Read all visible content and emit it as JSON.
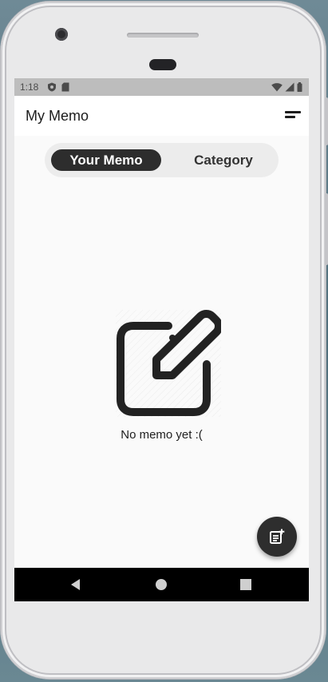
{
  "status_bar": {
    "time": "1:18",
    "icons": [
      "shield-icon",
      "sd-card-icon",
      "wifi-icon",
      "signal-icon",
      "battery-icon"
    ]
  },
  "app_bar": {
    "title": "My Memo",
    "menu_icon": "sort-menu-icon"
  },
  "tabs": [
    {
      "label": "Your Memo",
      "active": true
    },
    {
      "label": "Category",
      "active": false
    }
  ],
  "empty_state": {
    "icon": "edit-note-icon",
    "message": "No memo yet :("
  },
  "fab": {
    "icon": "add-note-icon"
  },
  "nav_bar": {
    "buttons": [
      "back-icon",
      "home-icon",
      "recents-icon"
    ]
  },
  "colors": {
    "accent": "#2d2d2d",
    "background": "#fafafa",
    "status_bar": "#bdbdbd"
  }
}
